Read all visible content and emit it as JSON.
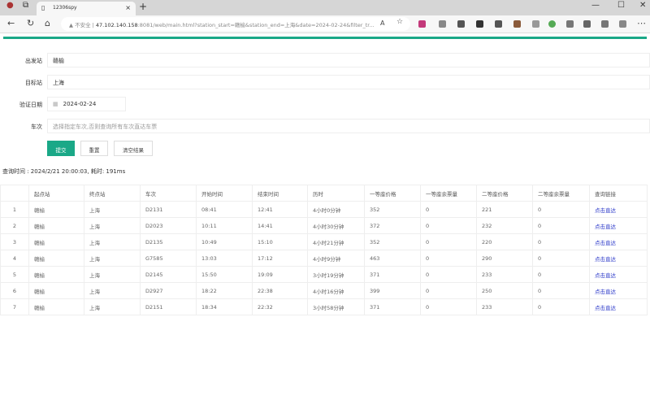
{
  "browser": {
    "tab_title": "12306spy",
    "security": "不安全",
    "url_host": "47.102.140.158",
    "url_rest": ":8081/web/main.html?station_start=赣榆&station_end=上海&date=2024-02-24&filter_tr..."
  },
  "form": {
    "start_label": "出发站",
    "start_value": "赣榆",
    "end_label": "目标站",
    "end_value": "上海",
    "date_label": "验证日期",
    "date_value": "2024-02-24",
    "train_label": "车次",
    "train_placeholder": "选择指定车次,否则查询所有车次直达车票",
    "submit": "提交",
    "reset": "重置",
    "clear": "清空结果"
  },
  "query_time": "查询时间 : 2024/2/21 20:00:03, 耗时: 191ms",
  "table": {
    "headers": [
      "",
      "起点站",
      "终点站",
      "车次",
      "开始时间",
      "结束时间",
      "历时",
      "一等座价格",
      "一等座余票量",
      "二等座价格",
      "二等座余票量",
      "查询链接"
    ],
    "rows": [
      [
        "1",
        "赣榆",
        "上海",
        "D2131",
        "08:41",
        "12:41",
        "4小时0分钟",
        "352",
        "0",
        "221",
        "0",
        "点击直达"
      ],
      [
        "2",
        "赣榆",
        "上海",
        "D2023",
        "10:11",
        "14:41",
        "4小时30分钟",
        "372",
        "0",
        "232",
        "0",
        "点击直达"
      ],
      [
        "3",
        "赣榆",
        "上海",
        "D2135",
        "10:49",
        "15:10",
        "4小时21分钟",
        "352",
        "0",
        "220",
        "0",
        "点击直达"
      ],
      [
        "4",
        "赣榆",
        "上海",
        "G7585",
        "13:03",
        "17:12",
        "4小时9分钟",
        "463",
        "0",
        "290",
        "0",
        "点击直达"
      ],
      [
        "5",
        "赣榆",
        "上海",
        "D2145",
        "15:50",
        "19:09",
        "3小时19分钟",
        "371",
        "0",
        "233",
        "0",
        "点击直达"
      ],
      [
        "6",
        "赣榆",
        "上海",
        "D2927",
        "18:22",
        "22:38",
        "4小时16分钟",
        "399",
        "0",
        "250",
        "0",
        "点击直达"
      ],
      [
        "7",
        "赣榆",
        "上海",
        "D2151",
        "18:34",
        "22:32",
        "3小时58分钟",
        "371",
        "0",
        "233",
        "0",
        "点击直达"
      ]
    ]
  },
  "colors": {
    "accent": "#1aa887",
    "link": "#2b38c9"
  }
}
